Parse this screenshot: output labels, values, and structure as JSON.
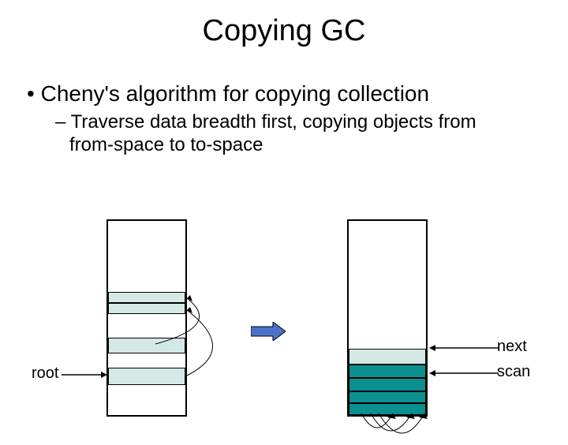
{
  "title": "Copying GC",
  "bullet1": "Cheny's algorithm for copying collection",
  "bullet2": "Traverse data breadth first, copying objects from from-space to to-space",
  "labels": {
    "root": "root",
    "next": "next",
    "scan": "scan"
  }
}
